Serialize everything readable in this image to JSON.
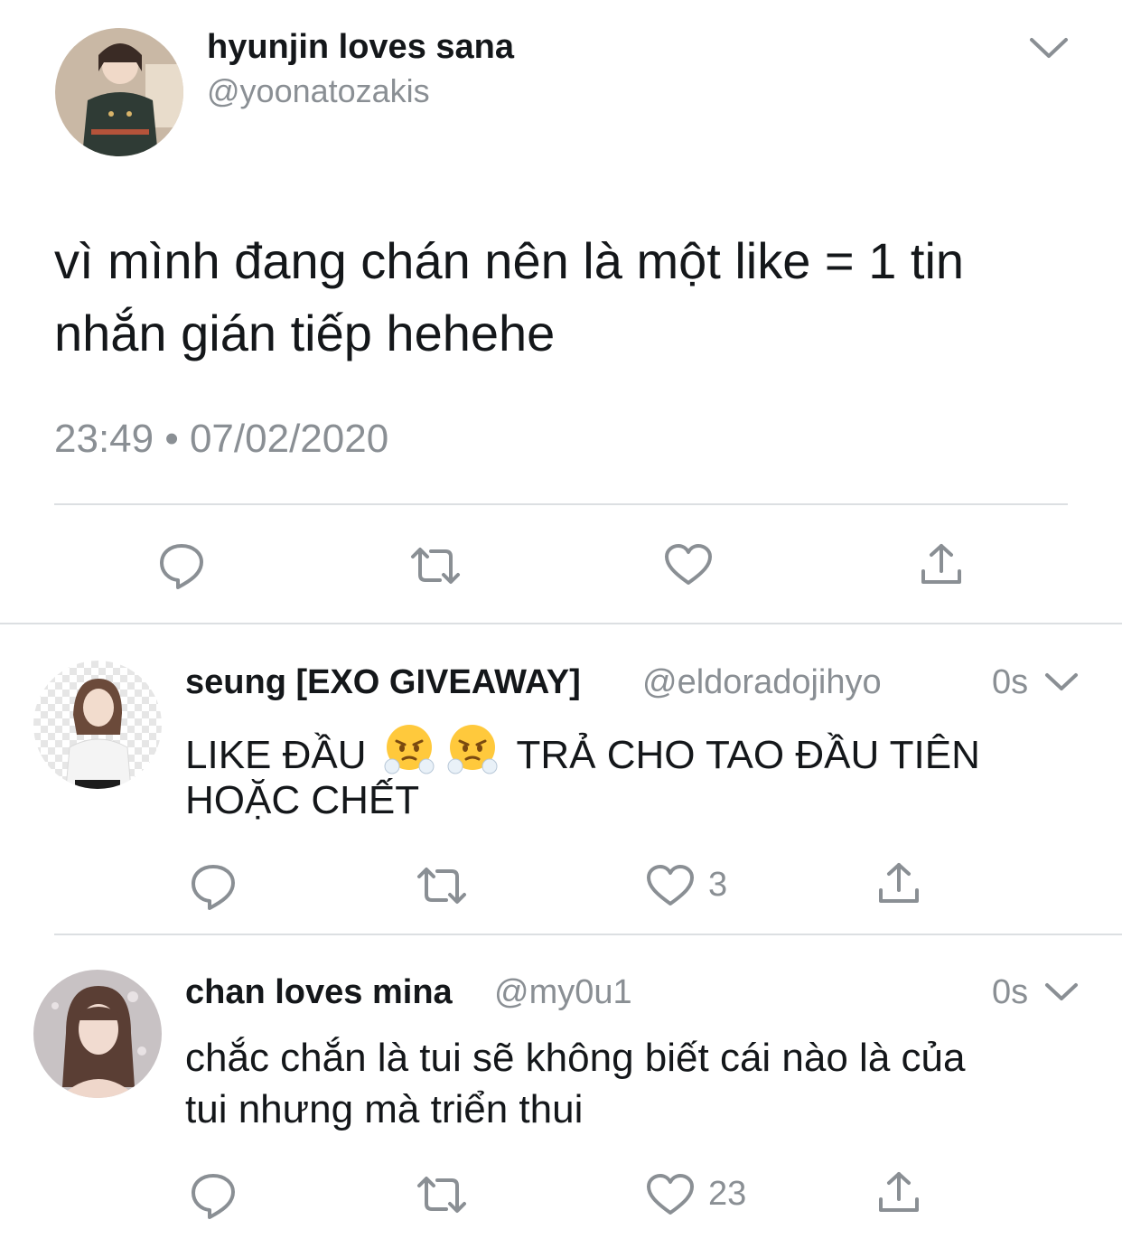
{
  "main_tweet": {
    "display_name": "hyunjin loves sana",
    "handle": "@yoonatozakis",
    "text_line1": "vì mình đang chán nên là một like = 1 tin",
    "text_line2": "nhắn gián tiếp hehehe",
    "timestamp": "23:49 • 07/02/2020"
  },
  "replies": [
    {
      "display_name": "seung [EXO GIVEAWAY]",
      "handle": "@eldoradojihyo",
      "time": "0s",
      "text_pre_emoji": "LIKE ĐẦU",
      "text_post_emoji": "TRẢ CHO TAO ĐẦU TIÊN",
      "text_line2": "HOẶC CHẾT",
      "likes": "3"
    },
    {
      "display_name": "chan loves mina",
      "handle": "@my0u1",
      "time": "0s",
      "text_line1": "chắc chắn là tui sẽ không biết cái nào là của",
      "text_line2": "tui nhưng mà triển thui",
      "likes": "23"
    }
  ],
  "colors": {
    "icon": "#8a8f94",
    "separator": "#dcdfe2",
    "text": "#14171a",
    "secondary": "#8a8f94"
  }
}
